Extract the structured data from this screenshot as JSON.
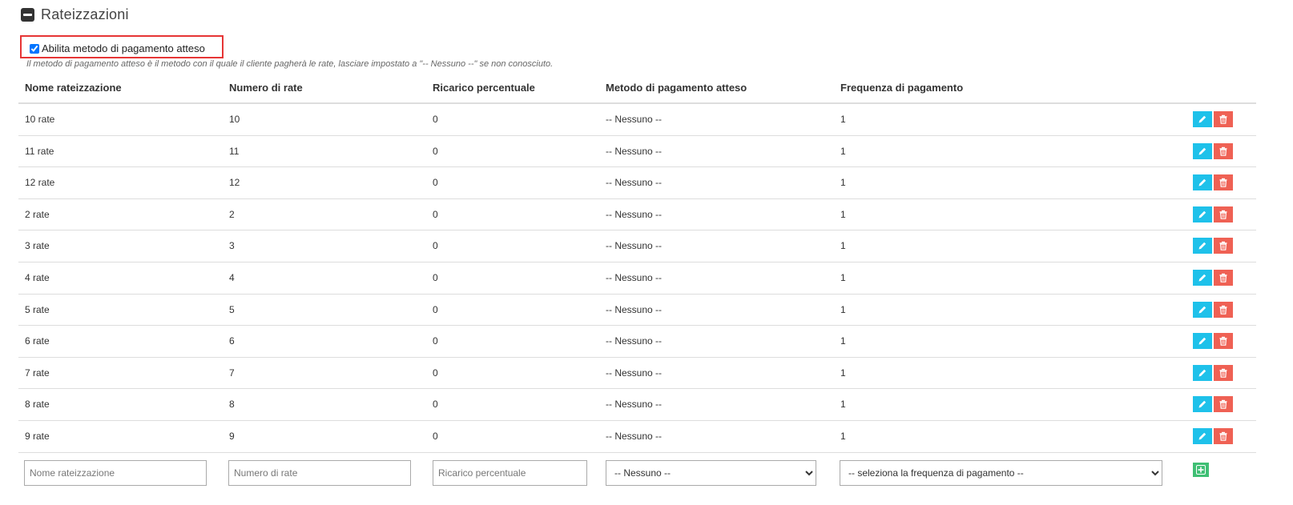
{
  "section": {
    "title": "Rateizzazioni"
  },
  "option": {
    "checkbox_label": "Abilita metodo di pagamento atteso",
    "checked": true,
    "help_text": "Il metodo di pagamento atteso è il metodo con il quale il cliente pagherà le rate, lasciare impostato a \"-- Nessuno --\" se non conosciuto."
  },
  "table": {
    "columns": [
      "Nome rateizzazione",
      "Numero di rate",
      "Ricarico percentuale",
      "Metodo di pagamento atteso",
      "Frequenza di pagamento"
    ],
    "rows": [
      {
        "name": "10 rate",
        "count": "10",
        "surcharge": "0",
        "method": "-- Nessuno --",
        "frequency": "1"
      },
      {
        "name": "11 rate",
        "count": "11",
        "surcharge": "0",
        "method": "-- Nessuno --",
        "frequency": "1"
      },
      {
        "name": "12 rate",
        "count": "12",
        "surcharge": "0",
        "method": "-- Nessuno --",
        "frequency": "1"
      },
      {
        "name": "2 rate",
        "count": "2",
        "surcharge": "0",
        "method": "-- Nessuno --",
        "frequency": "1"
      },
      {
        "name": "3 rate",
        "count": "3",
        "surcharge": "0",
        "method": "-- Nessuno --",
        "frequency": "1"
      },
      {
        "name": "4 rate",
        "count": "4",
        "surcharge": "0",
        "method": "-- Nessuno --",
        "frequency": "1"
      },
      {
        "name": "5 rate",
        "count": "5",
        "surcharge": "0",
        "method": "-- Nessuno --",
        "frequency": "1"
      },
      {
        "name": "6 rate",
        "count": "6",
        "surcharge": "0",
        "method": "-- Nessuno --",
        "frequency": "1"
      },
      {
        "name": "7 rate",
        "count": "7",
        "surcharge": "0",
        "method": "-- Nessuno --",
        "frequency": "1"
      },
      {
        "name": "8 rate",
        "count": "8",
        "surcharge": "0",
        "method": "-- Nessuno --",
        "frequency": "1"
      },
      {
        "name": "9 rate",
        "count": "9",
        "surcharge": "0",
        "method": "-- Nessuno --",
        "frequency": "1"
      }
    ],
    "row_icons": [
      "pencil-icon",
      "trash-icon"
    ]
  },
  "form": {
    "name_placeholder": "Nome rateizzazione",
    "count_placeholder": "Numero di rate",
    "surcharge_placeholder": "Ricarico percentuale",
    "method_selected": "-- Nessuno --",
    "frequency_selected": "-- seleziona la frequenza di pagamento --",
    "add_icon": "plus-icon"
  },
  "colors": {
    "edit_button": "#1ec1ea",
    "delete_button": "#ef6154",
    "add_button": "#3fbf74",
    "highlight_box": "#e63535"
  }
}
